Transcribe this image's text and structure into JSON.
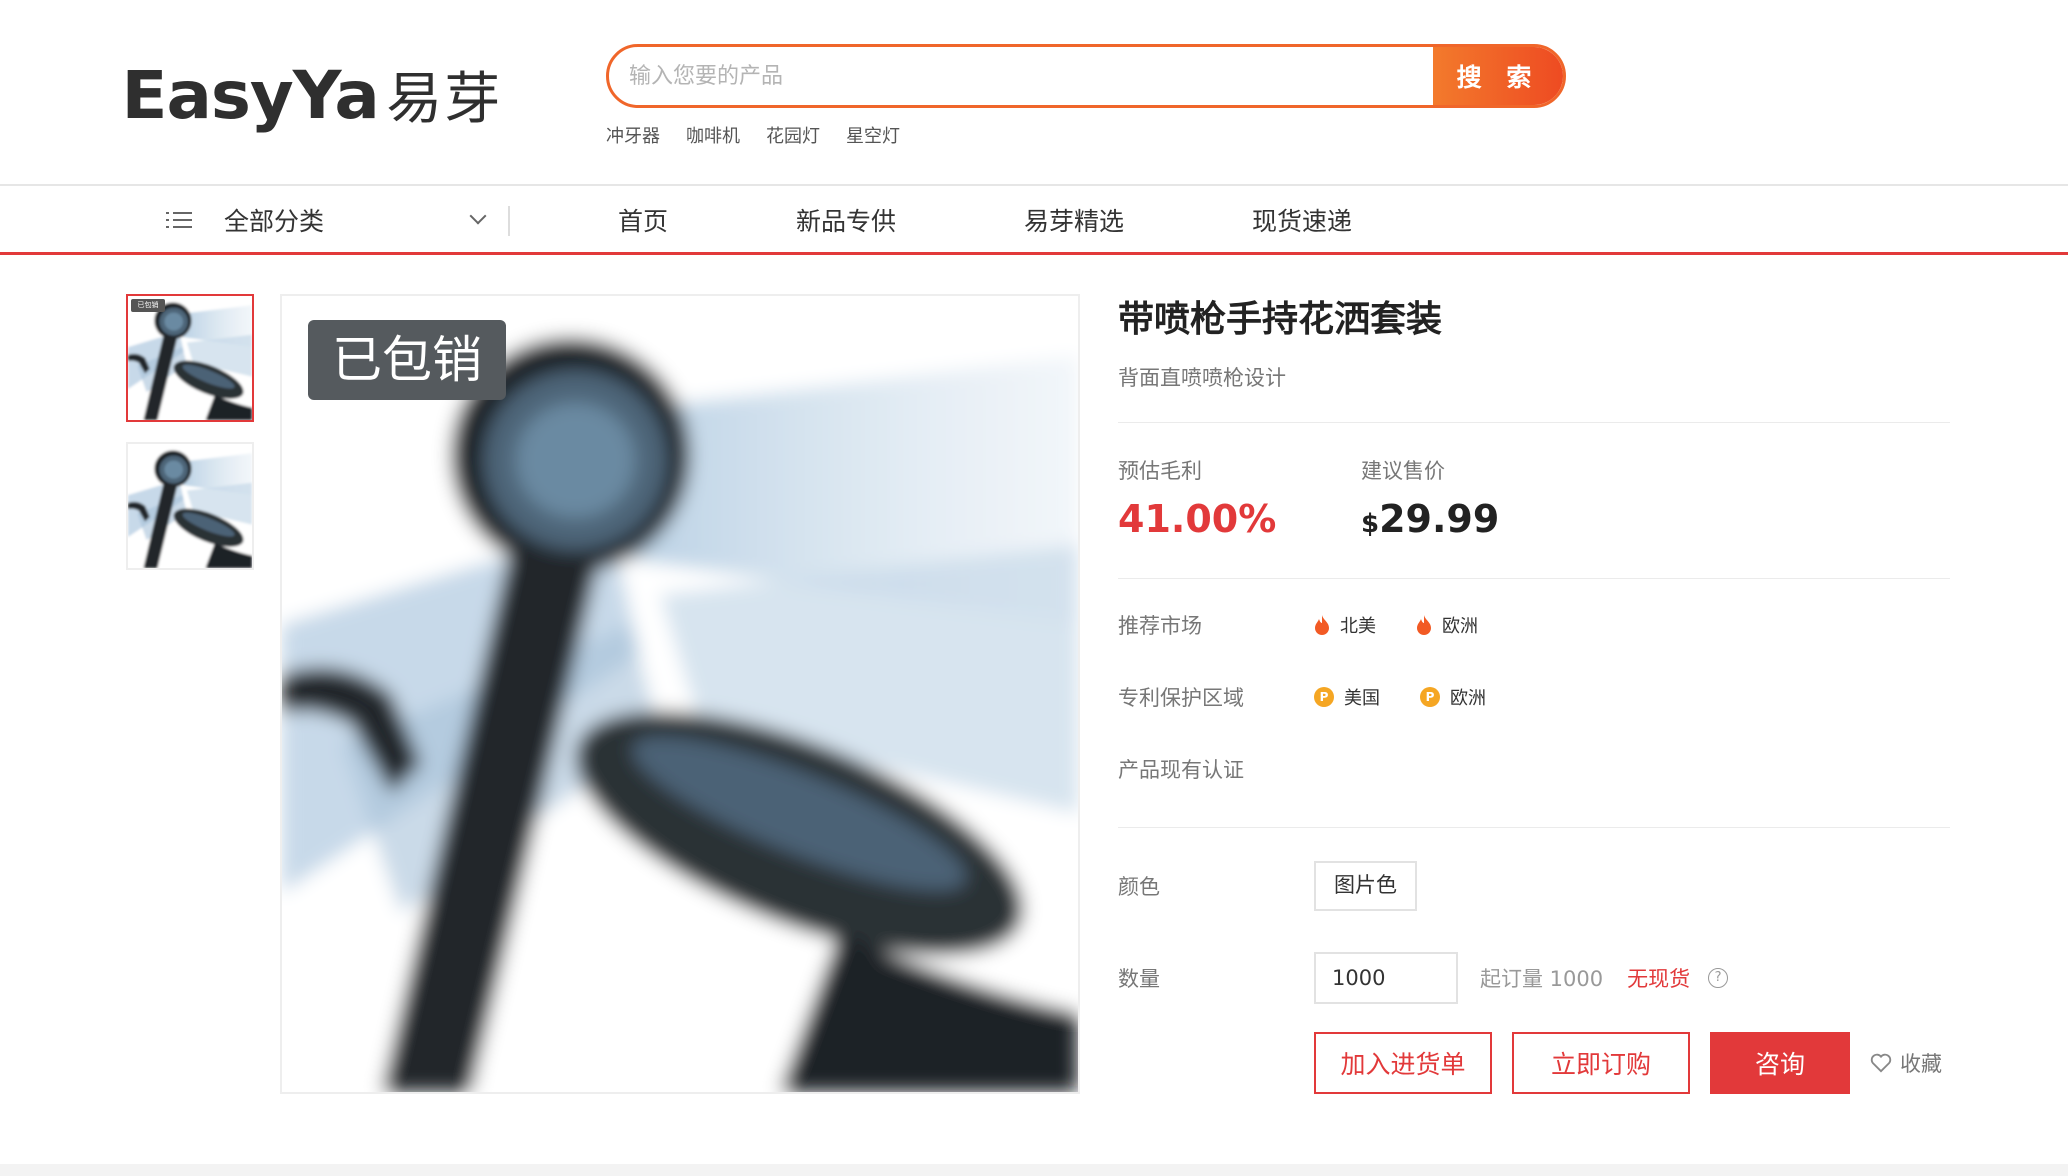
{
  "brand": {
    "logo_latin": "EasyYa",
    "logo_cn": "易芽"
  },
  "search": {
    "placeholder": "输入您要的产品",
    "value": "",
    "button_label": "搜 索",
    "hot_words": [
      "冲牙器",
      "咖啡机",
      "花园灯",
      "星空灯"
    ]
  },
  "nav": {
    "all_categories": "全部分类",
    "items": [
      "首页",
      "新品专供",
      "易芽精选",
      "现货速递"
    ]
  },
  "gallery": {
    "sold_badge": "已包销",
    "thumb_badge": "已包销",
    "thumb_count": 2,
    "active_thumb": 0
  },
  "product": {
    "title": "带喷枪手持花洒套装",
    "subtitle": "背面直喷喷枪设计",
    "margin_label": "预估毛利",
    "margin_value": "41.00%",
    "price_label": "建议售价",
    "price_currency": "$",
    "price_value": "29.99",
    "market_label": "推荐市场",
    "markets": [
      "北美",
      "欧洲"
    ],
    "patent_label": "专利保护区域",
    "patents": [
      "美国",
      "欧洲"
    ],
    "patent_icon": "P",
    "cert_label": "产品现有认证",
    "color_label": "颜色",
    "color_option": "图片色",
    "qty_label": "数量",
    "qty_value": "1000",
    "moq_text": "起订量 1000",
    "stock_text": "无现货",
    "add_to_list": "加入进货单",
    "order_now": "立即订购",
    "consult": "咨询",
    "favorite": "收藏"
  },
  "colors": {
    "accent": "#e2393a",
    "search_orange": "#f0662a",
    "badge_gray": "#555a5e",
    "patent_gold": "#f5a623"
  }
}
